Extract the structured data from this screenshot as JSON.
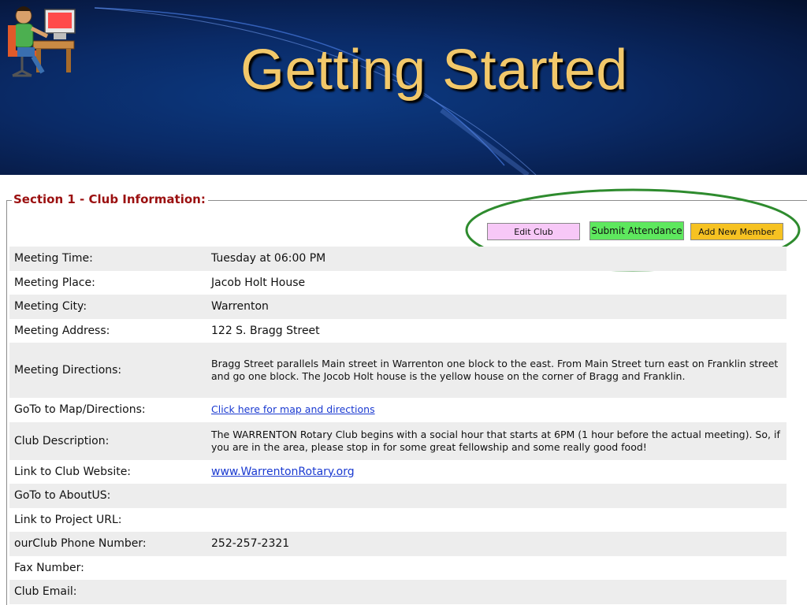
{
  "slide": {
    "title": "Getting Started"
  },
  "section": {
    "legend": "Section 1 - Club Information:"
  },
  "buttons": {
    "edit_club": "Edit Club",
    "submit_attendance": "Submit Attendance",
    "add_new_member": "Add New Member"
  },
  "colors": {
    "legend_text": "#9b1010",
    "edit_club_bg": "#f7c8f7",
    "submit_attendance_bg": "#5ee85e",
    "add_new_member_bg": "#f6c222",
    "highlight_oval": "#2e8b2e",
    "link": "#1a3ad1",
    "title": "#f2c86a"
  },
  "rows": [
    {
      "label": "Meeting Time:",
      "value": "Tuesday at 06:00 PM"
    },
    {
      "label": "Meeting Place:",
      "value": "Jacob Holt House"
    },
    {
      "label": "Meeting City:",
      "value": "Warrenton"
    },
    {
      "label": "Meeting Address:",
      "value": "122 S. Bragg Street"
    },
    {
      "label": "Meeting Directions:",
      "value": "Bragg Street parallels Main street in Warrenton one block to the east. From Main Street turn east on Franklin street and go one block. The Jocob Holt house is the yellow house on the corner of Bragg and Franklin."
    },
    {
      "label": "GoTo to Map/Directions:",
      "value": "Click here for map and directions"
    },
    {
      "label": "Club Description:",
      "value": "The WARRENTON Rotary Club begins with a social hour that starts at 6PM (1 hour before the actual meeting). So, if you are in the area, please stop in for some great fellowship and some really good food!"
    },
    {
      "label": "Link to Club Website:",
      "value": "www.WarrentonRotary.org"
    },
    {
      "label": "GoTo to AboutUS:",
      "value": ""
    },
    {
      "label": "Link to Project URL:",
      "value": ""
    },
    {
      "label": "ourClub Phone Number:",
      "value": "252-257-2321"
    },
    {
      "label": "Fax Number:",
      "value": ""
    },
    {
      "label": "Club Email:",
      "value": ""
    }
  ]
}
